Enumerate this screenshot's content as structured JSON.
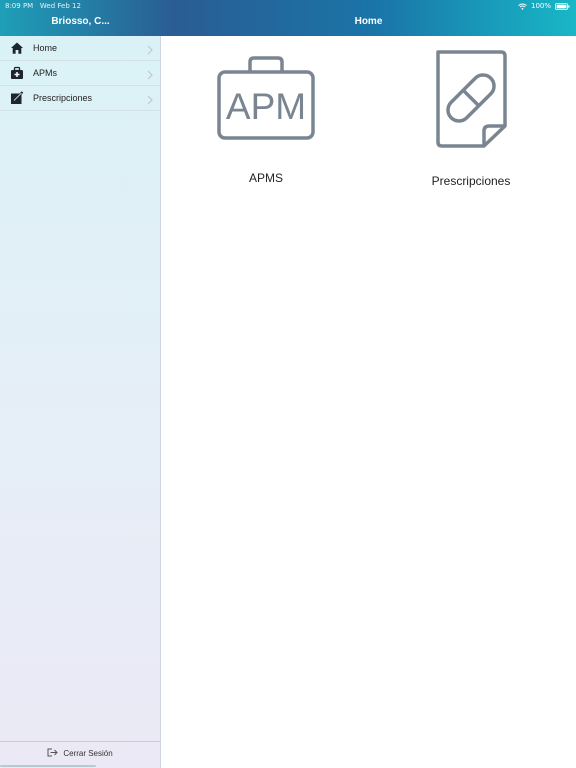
{
  "status_bar": {
    "time": "8:09 PM",
    "date": "Wed Feb 12",
    "battery": "100%"
  },
  "sidebar": {
    "title": "Briosso, C...",
    "items": [
      {
        "label": "Home",
        "icon": "home-icon"
      },
      {
        "label": "APMs",
        "icon": "medical-kit-icon"
      },
      {
        "label": "Prescripciones",
        "icon": "prescription-icon"
      }
    ],
    "logout_label": "Cerrar Sesión"
  },
  "main": {
    "title": "Home",
    "tiles": [
      {
        "label": "APMS",
        "icon": "apm-briefcase-icon",
        "icon_text": "APM"
      },
      {
        "label": "Prescripciones",
        "icon": "pill-document-icon"
      }
    ]
  },
  "colors": {
    "header_start": "#1e9fb8",
    "header_end": "#18b7c6",
    "icon_gray": "#7a8591"
  }
}
